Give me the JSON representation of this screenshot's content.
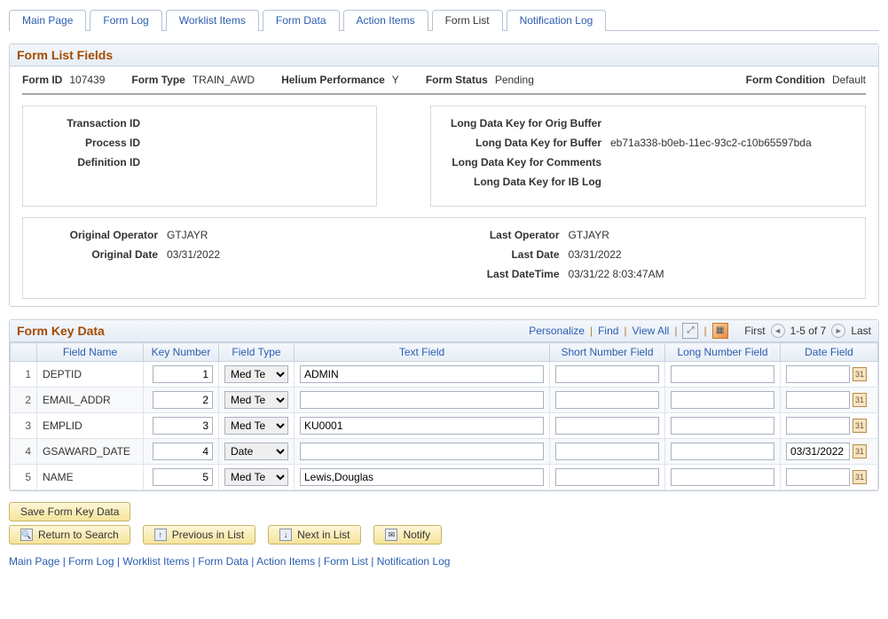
{
  "tabs": [
    "Main Page",
    "Form Log",
    "Worklist Items",
    "Form Data",
    "Action Items",
    "Form List",
    "Notification Log"
  ],
  "active_tab": 5,
  "panel1": {
    "title": "Form List Fields",
    "header": {
      "form_id_lbl": "Form ID",
      "form_id": "107439",
      "form_type_lbl": "Form Type",
      "form_type": "TRAIN_AWD",
      "helium_lbl": "Helium Performance",
      "helium": "Y",
      "status_lbl": "Form Status",
      "status": "Pending",
      "condition_lbl": "Form Condition",
      "condition": "Default"
    },
    "left_box": {
      "transaction_id_lbl": "Transaction ID",
      "transaction_id": "",
      "process_id_lbl": "Process ID",
      "process_id": "",
      "definition_id_lbl": "Definition ID",
      "definition_id": ""
    },
    "right_box": {
      "orig_buffer_lbl": "Long Data Key for Orig Buffer",
      "orig_buffer": "",
      "buffer_lbl": "Long Data Key for Buffer",
      "buffer": "eb71a338-b0eb-11ec-93c2-c10b65597bda",
      "comments_lbl": "Long Data Key for Comments",
      "comments": "",
      "iblog_lbl": "Long Data Key for IB Log",
      "iblog": ""
    },
    "origin": {
      "orig_op_lbl": "Original Operator",
      "orig_op": "GTJAYR",
      "orig_date_lbl": "Original Date",
      "orig_date": "03/31/2022",
      "last_op_lbl": "Last Operator",
      "last_op": "GTJAYR",
      "last_date_lbl": "Last Date",
      "last_date": "03/31/2022",
      "last_dt_lbl": "Last DateTime",
      "last_dt": "03/31/22  8:03:47AM"
    }
  },
  "grid": {
    "title": "Form Key Data",
    "toolbar": {
      "personalize": "Personalize",
      "find": "Find",
      "view_all": "View All",
      "first": "First",
      "last": "Last",
      "range": "1-5 of 7"
    },
    "columns": [
      "",
      "Field Name",
      "Key Number",
      "Field Type",
      "Text Field",
      "Short Number Field",
      "Long Number Field",
      "Date Field"
    ],
    "field_type_options": [
      "Med Te",
      "Date"
    ],
    "rows": [
      {
        "n": "1",
        "field_name": "DEPTID",
        "key_number": "1",
        "field_type": "Med Te",
        "text_field": "ADMIN",
        "short_num": "",
        "long_num": "",
        "date": ""
      },
      {
        "n": "2",
        "field_name": "EMAIL_ADDR",
        "key_number": "2",
        "field_type": "Med Te",
        "text_field": "",
        "short_num": "",
        "long_num": "",
        "date": ""
      },
      {
        "n": "3",
        "field_name": "EMPLID",
        "key_number": "3",
        "field_type": "Med Te",
        "text_field": "KU0001",
        "short_num": "",
        "long_num": "",
        "date": ""
      },
      {
        "n": "4",
        "field_name": "GSAWARD_DATE",
        "key_number": "4",
        "field_type": "Date",
        "text_field": "",
        "short_num": "",
        "long_num": "",
        "date": "03/31/2022"
      },
      {
        "n": "5",
        "field_name": "NAME",
        "key_number": "5",
        "field_type": "Med Te",
        "text_field": "Lewis,Douglas",
        "short_num": "",
        "long_num": "",
        "date": ""
      }
    ]
  },
  "buttons": {
    "save": "Save Form Key Data",
    "return": "Return to Search",
    "prev": "Previous in List",
    "next": "Next in List",
    "notify": "Notify"
  },
  "bottom_links": [
    "Main Page",
    "Form Log",
    "Worklist Items",
    "Form Data",
    "Action Items",
    "Form List",
    "Notification Log"
  ]
}
